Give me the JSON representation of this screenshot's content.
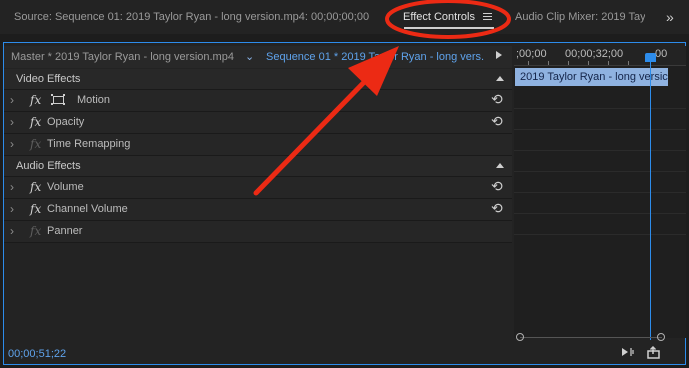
{
  "tabs": {
    "source": "Source: Sequence 01: 2019 Taylor Ryan - long version.mp4: 00;00;00;00",
    "effect_controls": "Effect Controls",
    "menu_icon": "hamburger-icon",
    "audio_mixer": "Audio Clip Mixer: 2019 Tay",
    "overflow_icon": "double-chevron-right-icon"
  },
  "subheader": {
    "master": "Master * 2019 Taylor Ryan - long version.mp4",
    "sequence": "Sequence 01 * 2019 Taylor Ryan - long vers...",
    "dropdown_icon": "chevron-down-icon",
    "play_icon": "play-icon"
  },
  "video_effects": {
    "header": "Video Effects",
    "rows": [
      {
        "label": "Motion",
        "fx": "fx",
        "has_reset": true,
        "enabled": true
      },
      {
        "label": "Opacity",
        "fx": "fx",
        "has_reset": true,
        "enabled": true
      },
      {
        "label": "Time Remapping",
        "fx": "fx",
        "has_reset": false,
        "enabled": false
      }
    ]
  },
  "audio_effects": {
    "header": "Audio Effects",
    "rows": [
      {
        "label": "Volume",
        "fx": "fx",
        "has_reset": true,
        "enabled": true
      },
      {
        "label": "Channel Volume",
        "fx": "fx",
        "has_reset": true,
        "enabled": true
      },
      {
        "label": "Panner",
        "fx": "fx",
        "has_reset": false,
        "enabled": false
      }
    ]
  },
  "timeline": {
    "ruler_start": ";00;00",
    "ruler_mid": "00;00;32;00",
    "ruler_end": "00",
    "clip_label": "2019 Taylor Ryan - long versic"
  },
  "footer": {
    "timecode": "00;00;51;22",
    "play_only_icon": "play-audio-icon",
    "export_icon": "export-icon"
  },
  "colors": {
    "accent_blue": "#2d8ceb",
    "annotation_red": "#ec2a14",
    "clip_fill": "#8fb2e0"
  }
}
